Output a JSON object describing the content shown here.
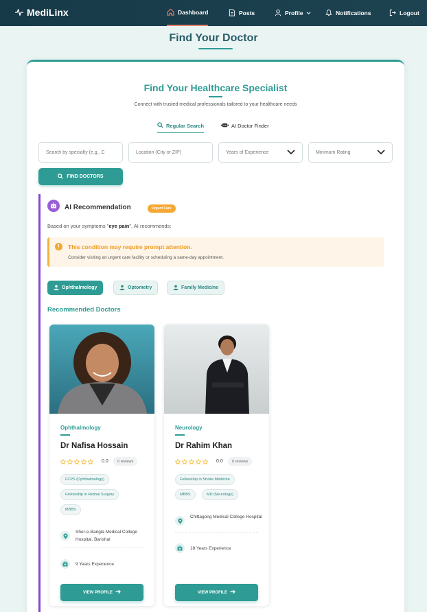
{
  "nav": {
    "brand": "MediLinx",
    "items": [
      {
        "label": "Dashboard",
        "icon": "home-icon"
      },
      {
        "label": "Posts",
        "icon": "document-icon"
      },
      {
        "label": "Profile",
        "icon": "user-icon"
      },
      {
        "label": "Notifications",
        "icon": "bell-icon"
      },
      {
        "label": "Logout",
        "icon": "logout-icon"
      }
    ]
  },
  "page": {
    "title": "Find Your Doctor"
  },
  "search_card": {
    "title": "Find Your Healthcare Specialist",
    "subtitle": "Connect with trusted medical professionals tailored to your healthcare needs",
    "modes": [
      {
        "label": "Regular Search"
      },
      {
        "label": "AI Doctor Finder"
      }
    ],
    "specialty_placeholder": "Search by specialty (e.g., C",
    "location_placeholder": "Location (City or ZIP)",
    "experience_select": "Years of Experience",
    "rating_select": "Minimum Rating",
    "find_button": "FIND DOCTORS"
  },
  "ai": {
    "title": "AI Recommendation",
    "badge": "Urgent Care",
    "desc_prefix": "Based on your symptoms \"",
    "symptom": "eye pain",
    "desc_suffix": "\", AI recommends:",
    "alert_title": "This condition may require prompt attention.",
    "alert_text": "Consider visiting an urgent care facility or scheduling a same-day appointment.",
    "specialties": [
      {
        "label": "Ophthalmology"
      },
      {
        "label": "Optometry"
      },
      {
        "label": "Family Medicine"
      }
    ],
    "recommended_title": "Recommended Doctors"
  },
  "doctors": [
    {
      "specialty": "Ophthalmology",
      "name": "Dr Nafisa Hossain",
      "rating": "0.0",
      "rating_value": 0,
      "reviews": "0 reviews",
      "qualifications": [
        "FCPS (Ophthalmology)",
        "Fellowship in Retinal Surgery",
        "MBBS"
      ],
      "hospital": "Sher-e-Bangla Medical College Hospital, Barishal",
      "experience": "9 Years Experience",
      "button": "VIEW PROFILE"
    },
    {
      "specialty": "Neurology",
      "name": "Dr Rahim Khan",
      "rating": "0.0",
      "rating_value": 0,
      "reviews": "0 reviews",
      "qualifications": [
        "Fellowship in Stroke Medicine",
        "MBBS",
        "MD (Neurology)"
      ],
      "hospital": "Chittagong Medical College Hospital",
      "experience": "18 Years Experience",
      "button": "VIEW PROFILE"
    }
  ],
  "colors": {
    "primary": "#2e9c94",
    "nav": "#1d4250",
    "accent": "#8546c8",
    "warning": "#f3a830",
    "star": "#f5b52a"
  }
}
